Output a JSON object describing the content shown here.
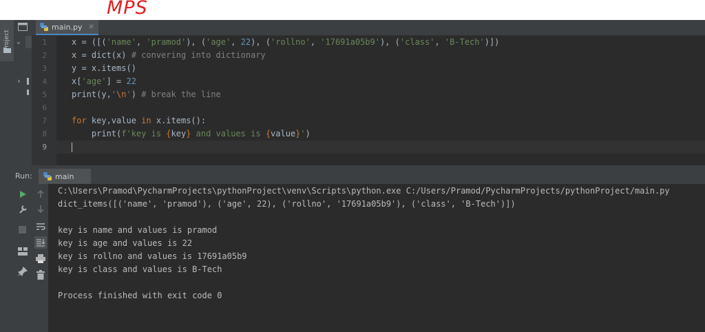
{
  "annotation": "MPS",
  "sidebar": {
    "project_label": "Project"
  },
  "editor": {
    "tab_label": "main.py",
    "line_numbers": [
      "1",
      "2",
      "3",
      "4",
      "5",
      "6",
      "7",
      "8",
      "9"
    ],
    "lines": [
      "x = ([('name', 'pramod'), ('age', 22), ('rollno', '17691a05b9'), ('class', 'B-Tech')])",
      "x = dict(x) # convering into dictionary",
      "y = x.items()",
      "x['age'] = 22",
      "print(y,'\\n') # break the line",
      "",
      "for key,value in x.items():",
      "    print(f'key is {key} and values is {value}')",
      ""
    ]
  },
  "run": {
    "label": "Run:",
    "tab_label": "main",
    "output": [
      "C:\\Users\\Pramod\\PycharmProjects\\pythonProject\\venv\\Scripts\\python.exe C:/Users/Pramod/PycharmProjects/pythonProject/main.py",
      "dict_items([('name', 'pramod'), ('age', 22), ('rollno', '17691a05b9'), ('class', 'B-Tech')])",
      "",
      "key is name and values is pramod",
      "key is age and values is 22",
      "key is rollno and values is 17691a05b9",
      "key is class and values is B-Tech",
      "",
      "Process finished with exit code 0"
    ]
  },
  "colors": {
    "keyword": "#cc7832",
    "string": "#6a8759",
    "number": "#6897bb",
    "comment": "#808080",
    "run_green": "#59a869"
  }
}
